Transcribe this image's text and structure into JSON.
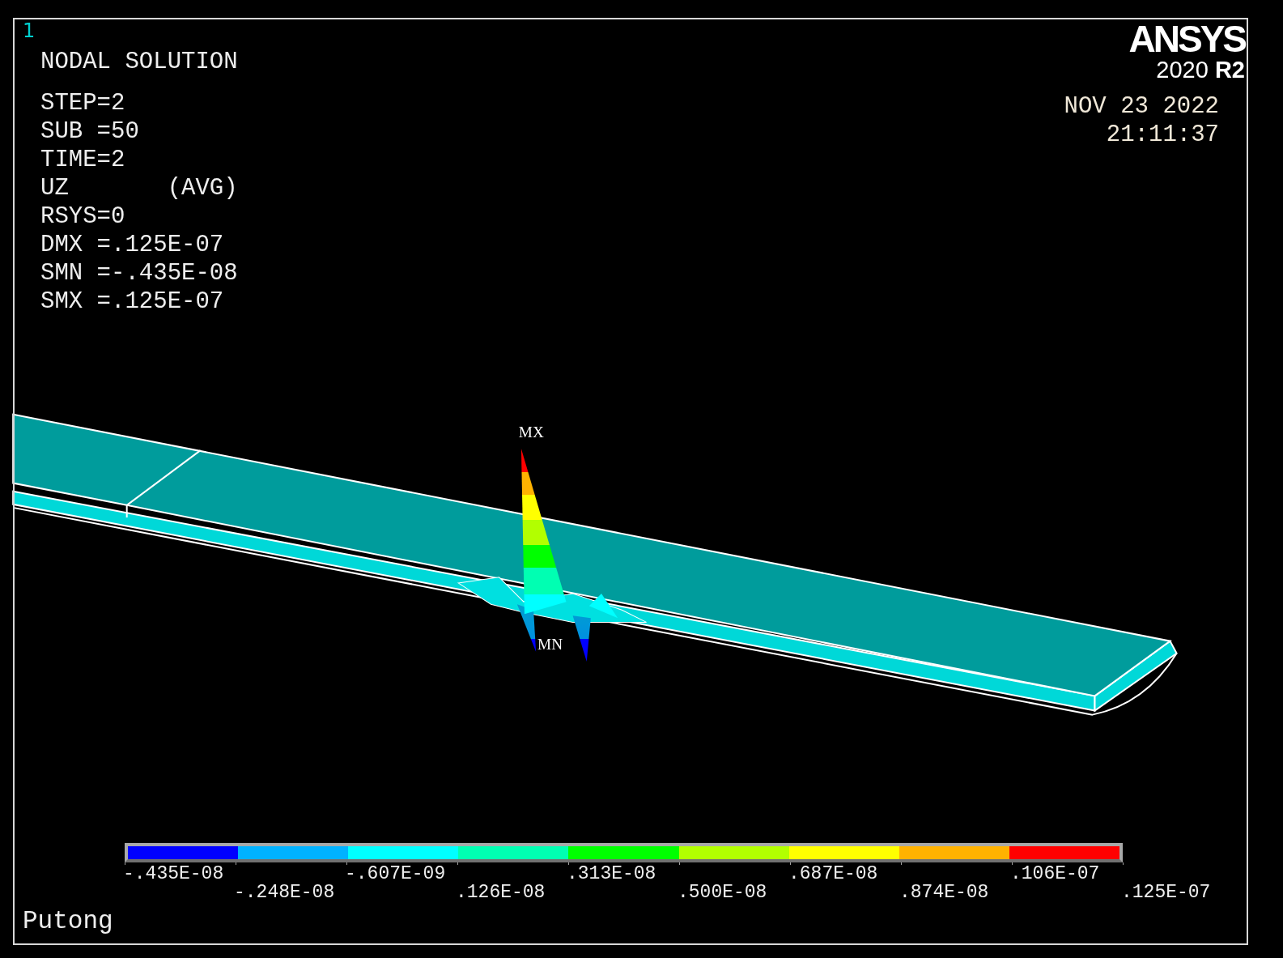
{
  "viewport_number": "1",
  "title": "NODAL SOLUTION",
  "info_lines": [
    "STEP=2",
    "SUB =50",
    "TIME=2",
    "UZ       (AVG)",
    "RSYS=0",
    "DMX =.125E-07",
    "SMN =-.435E-08",
    "SMX =.125E-07"
  ],
  "logo": {
    "name": "ANSYS",
    "version": "2020 **R2**"
  },
  "date_lines": [
    "NOV 23 2022",
    "21:11:37"
  ],
  "model": {
    "max_label": "MX",
    "min_label": "MN"
  },
  "legend": {
    "bins": [
      {
        "color": "#0000ff"
      },
      {
        "color": "#00b2ff"
      },
      {
        "color": "#00ffff"
      },
      {
        "color": "#00ffb2"
      },
      {
        "color": "#00ff00"
      },
      {
        "color": "#b2ff00"
      },
      {
        "color": "#ffff00"
      },
      {
        "color": "#ffb200"
      },
      {
        "color": "#ff0000"
      }
    ],
    "labels": [
      "-.435E-08",
      "-.248E-08",
      "-.607E-09",
      ".126E-08",
      ".313E-08",
      ".500E-08",
      ".687E-08",
      ".874E-08",
      ".106E-07",
      ".125E-07"
    ]
  },
  "footer": "Putong"
}
